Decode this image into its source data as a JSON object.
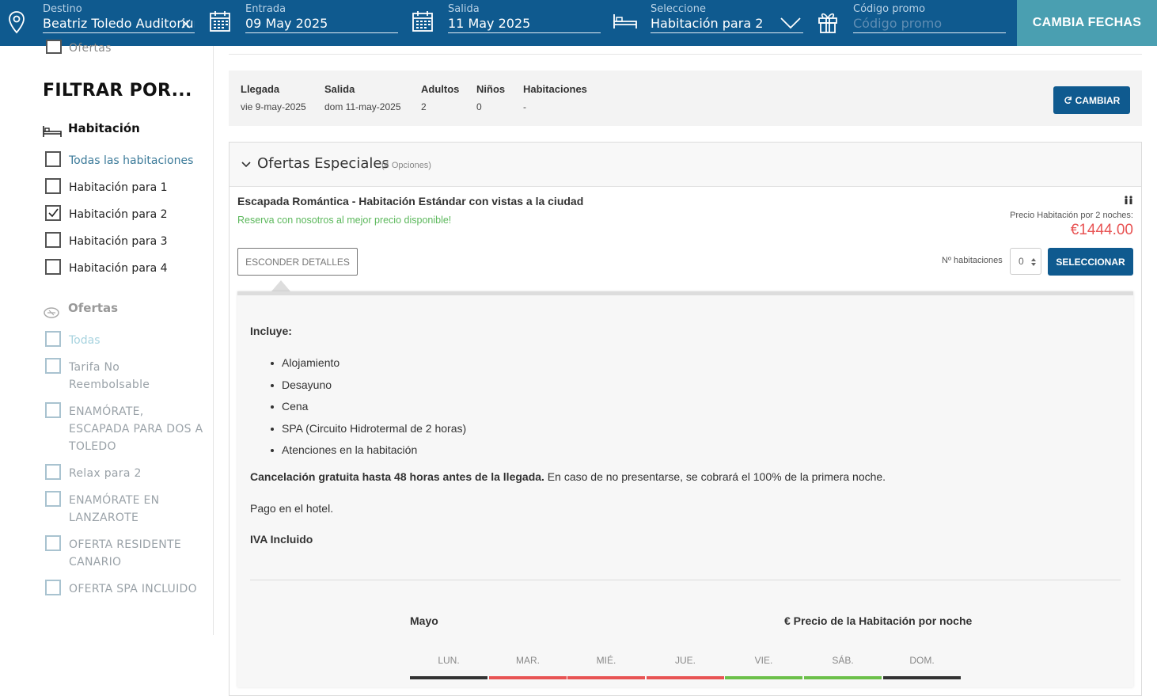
{
  "topbar": {
    "destino": {
      "label": "Destino",
      "value": "Beatriz Toledo Auditorium"
    },
    "entrada": {
      "label": "Entrada",
      "value": "09 May 2025"
    },
    "salida": {
      "label": "Salida",
      "value": "11 May 2025"
    },
    "seleccione": {
      "label": "Seleccione",
      "value": "Habitación para 2"
    },
    "promo": {
      "label": "Código promo",
      "placeholder": "Código promo"
    },
    "cambia_fechas": "CAMBIA FECHAS"
  },
  "sidebar": {
    "top_partial": "Ofertas",
    "filter_title": "FILTRAR POR...",
    "habitacion": {
      "title": "Habitación",
      "options": [
        {
          "label": "Todas las habitaciones",
          "checked": false
        },
        {
          "label": "Habitación para 1",
          "checked": false
        },
        {
          "label": "Habitación para 2",
          "checked": true
        },
        {
          "label": "Habitación para 3",
          "checked": false
        },
        {
          "label": "Habitación para 4",
          "checked": false
        }
      ]
    },
    "ofertas": {
      "title": "Ofertas",
      "options": [
        {
          "label": "Todas"
        },
        {
          "label": "Tarifa No Reembolsable"
        },
        {
          "label": "ENAMÓRATE, ESCAPADA PARA DOS A TOLEDO"
        },
        {
          "label": "Relax para 2"
        },
        {
          "label": "ENAMÓRATE EN LANZAROTE"
        },
        {
          "label": "OFERTA RESIDENTE CANARIO"
        },
        {
          "label": "OFERTA SPA INCLUIDO"
        }
      ]
    }
  },
  "summary": {
    "llegada": {
      "label": "Llegada",
      "value": "vie 9-may-2025"
    },
    "salida": {
      "label": "Salida",
      "value": "dom 11-may-2025"
    },
    "adultos": {
      "label": "Adultos",
      "value": "2"
    },
    "ninos": {
      "label": "Niños",
      "value": "0"
    },
    "habitaciones": {
      "label": "Habitaciones",
      "value": "-"
    },
    "cambiar": "CAMBIAR"
  },
  "offers_panel": {
    "title": "Ofertas Especiales",
    "count": "(4 Opciones)",
    "offer": {
      "name": "Escapada Romántica - Habitación Estándar con vistas a la ciudad",
      "tagline": "Reserva con nosotros al mejor precio disponible!",
      "price_label": "Precio Habitación por 2 noches:",
      "price": "€1444.00",
      "hide_details": "ESCONDER DETALLES",
      "rooms_label": "Nº habitaciones",
      "rooms_value": "0",
      "select": "SELECCIONAR"
    },
    "details": {
      "includes_title": "Incluye:",
      "includes": [
        "Alojamiento",
        "Desayuno",
        "Cena",
        "SPA (Circuito Hidrotermal de 2 horas)",
        "Atenciones en la habitación"
      ],
      "cancel_bold": "Cancelación gratuita hasta 48 horas antes de la llegada.",
      "cancel_rest": " En caso de no presentarse, se cobrará el 100% de la primera noche.",
      "payment": "Pago en el hotel.",
      "iva": "IVA Incluido",
      "calendar_month": "Mayo",
      "calendar_price_title": "€ Precio de la Habitación por noche",
      "days": [
        "LUN.",
        "MAR.",
        "MIÉ.",
        "JUE.",
        "VIE.",
        "SÁB.",
        "DOM."
      ]
    }
  },
  "colors": {
    "primary": "#0f5a8f",
    "accent": "#4a9fb1",
    "price": "#e85454",
    "tagline": "#5cb85c"
  }
}
